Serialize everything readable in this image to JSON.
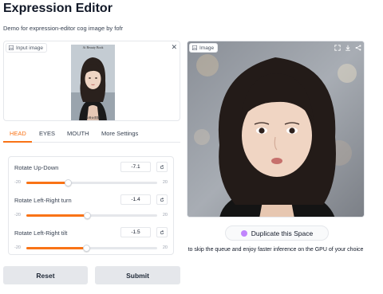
{
  "page": {
    "title": "Expression Editor",
    "subtitle": "Demo for expression-editor cog image by fofr"
  },
  "input_image": {
    "label": "Input image",
    "caption_top": "Ai Beauty Book",
    "caption_bottom": "AI美女图鉴"
  },
  "tabs": [
    {
      "label": "HEAD",
      "active": true
    },
    {
      "label": "EYES",
      "active": false
    },
    {
      "label": "MOUTH",
      "active": false
    },
    {
      "label": "More Settings",
      "active": false
    }
  ],
  "sliders": [
    {
      "label": "Rotate Up-Down",
      "value": -7.1,
      "display": "-7.1",
      "min": -20,
      "max": 20,
      "min_label": "-20",
      "max_label": "20"
    },
    {
      "label": "Rotate Left-Right turn",
      "value": -1.4,
      "display": "-1.4",
      "min": -20,
      "max": 20,
      "min_label": "-20",
      "max_label": "20"
    },
    {
      "label": "Rotate Left-Right tilt",
      "value": -1.5,
      "display": "-1.5",
      "min": -20,
      "max": 20,
      "min_label": "-20",
      "max_label": "20"
    }
  ],
  "buttons": {
    "reset": "Reset",
    "submit": "Submit"
  },
  "output_image": {
    "label": "Image"
  },
  "duplicate": {
    "button_label": "Duplicate this Space",
    "caption": "to skip the queue and enjoy faster inference on the GPU of your choice"
  },
  "colors": {
    "accent": "#f97316",
    "button_bg": "#e5e7eb",
    "border": "#e5e7eb"
  },
  "icons": [
    "image-icon",
    "close-icon",
    "reset-icon",
    "fullscreen-icon",
    "download-icon",
    "share-icon",
    "duplicate-icon"
  ]
}
